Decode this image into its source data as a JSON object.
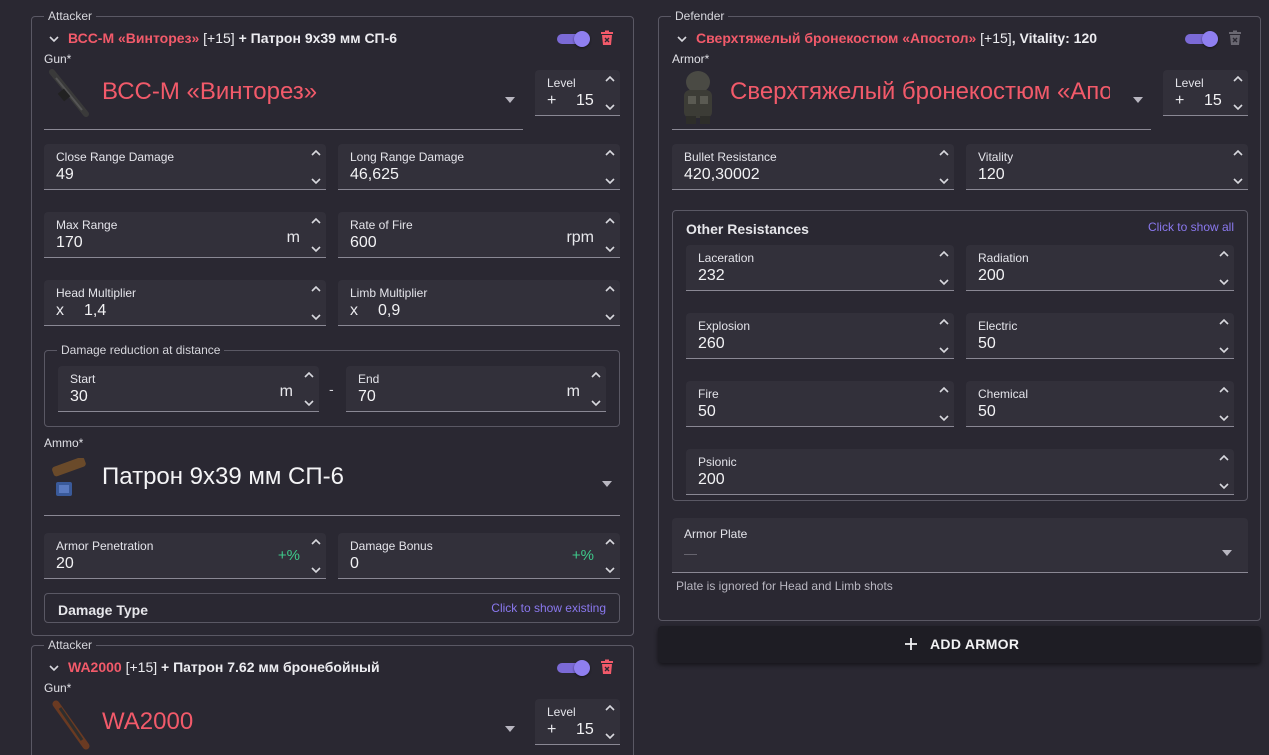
{
  "attacker1": {
    "legend": "Attacker",
    "header_gun": "ВСС-М «Винторез»",
    "header_level": "[+15]",
    "header_rest": "+ Патрон 9х39 мм СП-6",
    "gun_label": "Gun*",
    "gun_value": "ВСС-М «Винторез»",
    "level_label": "Level",
    "level_prefix": "+",
    "level_value": "15",
    "close_range_label": "Close Range Damage",
    "close_range_value": "49",
    "long_range_label": "Long Range Damage",
    "long_range_value": "46,625",
    "max_range_label": "Max Range",
    "max_range_value": "170",
    "max_range_unit": "m",
    "rof_label": "Rate of Fire",
    "rof_value": "600",
    "rof_unit": "rpm",
    "head_mult_label": "Head Multiplier",
    "head_mult_prefix": "x",
    "head_mult_value": "1,4",
    "limb_mult_label": "Limb Multiplier",
    "limb_mult_prefix": "x",
    "limb_mult_value": "0,9",
    "dmg_reduction_legend": "Damage reduction at distance",
    "start_label": "Start",
    "start_value": "30",
    "start_unit": "m",
    "range_sep": "-",
    "end_label": "End",
    "end_value": "70",
    "end_unit": "m",
    "ammo_label": "Ammo*",
    "ammo_value": "Патрон 9х39 мм СП-6",
    "armor_pen_label": "Armor Penetration",
    "armor_pen_value": "20",
    "armor_pen_unit": "+%",
    "dmg_bonus_label": "Damage Bonus",
    "dmg_bonus_value": "0",
    "dmg_bonus_unit": "+%",
    "dmg_type_title": "Damage Type",
    "dmg_type_link": "Click to show existing"
  },
  "attacker2": {
    "legend": "Attacker",
    "header_gun": "WA2000",
    "header_level": "[+15]",
    "header_rest": "+ Патрон 7.62 мм бронебойный",
    "gun_label": "Gun*",
    "gun_value": "WA2000",
    "level_label": "Level",
    "level_prefix": "+",
    "level_value": "15"
  },
  "defender": {
    "legend": "Defender",
    "header_armor": "Сверхтяжелый бронекостюм «Апостол»",
    "header_level": "[+15]",
    "header_rest": ", Vitality: 120",
    "armor_label": "Armor*",
    "armor_value": "Сверхтяжелый бронекостюм «Апостол»",
    "level_label": "Level",
    "level_prefix": "+",
    "level_value": "15",
    "bullet_res_label": "Bullet Resistance",
    "bullet_res_value": "420,30002",
    "vitality_label": "Vitality",
    "vitality_value": "120",
    "other_res_title": "Other Resistances",
    "other_res_link": "Click to show all",
    "laceration_label": "Laceration",
    "laceration_value": "232",
    "radiation_label": "Radiation",
    "radiation_value": "200",
    "explosion_label": "Explosion",
    "explosion_value": "260",
    "electric_label": "Electric",
    "electric_value": "50",
    "fire_label": "Fire",
    "fire_value": "50",
    "chemical_label": "Chemical",
    "chemical_value": "50",
    "psionic_label": "Psionic",
    "psionic_value": "200",
    "armor_plate_label": "Armor Plate",
    "armor_plate_value": "—",
    "plate_helper": "Plate is ignored for Head and Limb shots"
  },
  "add_armor_button": "ADD ARMOR",
  "colors": {
    "background": "#2a2832",
    "accent": "#7b6ad6",
    "danger": "#f25a6a",
    "link": "#8a78ee",
    "positive": "#3ec98a"
  }
}
